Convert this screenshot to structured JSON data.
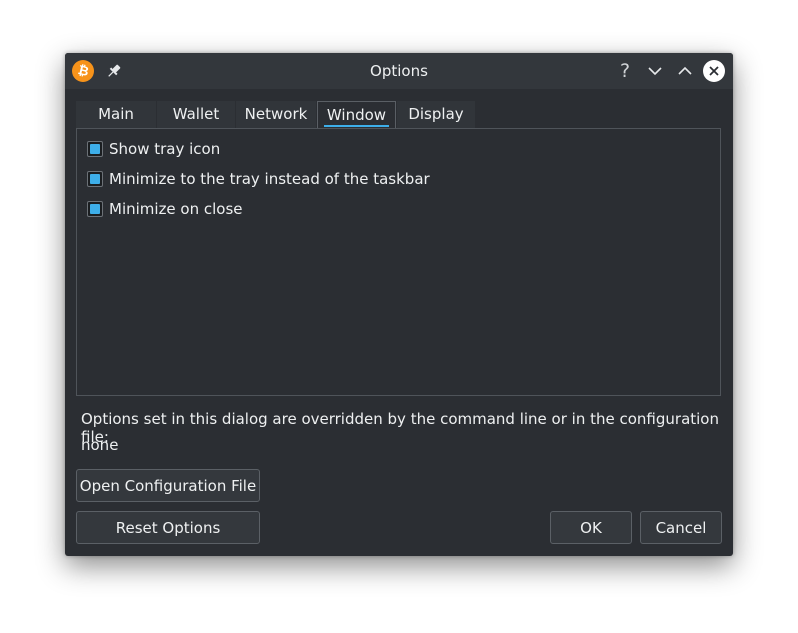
{
  "window": {
    "title": "Options",
    "app_icon_glyph": "₿",
    "help_glyph": "?"
  },
  "tabs": [
    {
      "label": "Main",
      "active": false
    },
    {
      "label": "Wallet",
      "active": false
    },
    {
      "label": "Network",
      "active": false
    },
    {
      "label": "Window",
      "active": true
    },
    {
      "label": "Display",
      "active": false
    }
  ],
  "window_tab": {
    "options": [
      {
        "label": "Show tray icon",
        "checked": true
      },
      {
        "label": "Minimize to the tray instead of the taskbar",
        "checked": true
      },
      {
        "label": "Minimize on close",
        "checked": true
      }
    ]
  },
  "notice": {
    "text": "Options set in this dialog are overridden by the command line or in the configuration file:",
    "value": "none"
  },
  "buttons": {
    "open_config": "Open Configuration File",
    "reset": "Reset Options",
    "ok": "OK",
    "cancel": "Cancel"
  },
  "colors": {
    "accent": "#3daee9",
    "background": "#2b2e33",
    "bitcoin_orange": "#f7931a"
  },
  "icons": {
    "app": "bitcoin-icon",
    "pin": "pin-icon",
    "help": "help-icon",
    "minimize": "chevron-down-icon",
    "maximize": "chevron-up-icon",
    "close": "close-icon"
  }
}
